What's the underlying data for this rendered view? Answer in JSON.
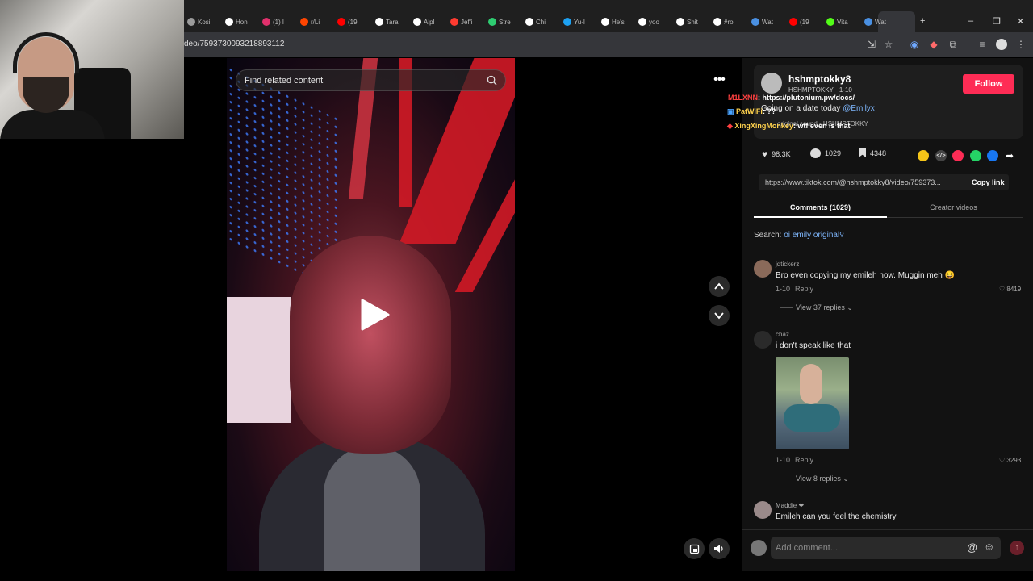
{
  "browser": {
    "tabs": [
      {
        "label": "Kosi",
        "color": "#9b9b9b"
      },
      {
        "label": "Hon",
        "color": "#ffffff"
      },
      {
        "label": "(1) l",
        "color": "#e1306c"
      },
      {
        "label": "r/Li",
        "color": "#ff4500"
      },
      {
        "label": "(19",
        "color": "#ff0000"
      },
      {
        "label": "Tara",
        "color": "#ffffff"
      },
      {
        "label": "Alpl",
        "color": "#ffffff"
      },
      {
        "label": "Jeffi",
        "color": "#ff3b30"
      },
      {
        "label": "Stre",
        "color": "#2ecc71"
      },
      {
        "label": "Chi",
        "color": "#ffffff"
      },
      {
        "label": "Yu-l",
        "color": "#1da1f2"
      },
      {
        "label": "He's",
        "color": "#ffffff"
      },
      {
        "label": "yoo",
        "color": "#ffffff"
      },
      {
        "label": "Shit",
        "color": "#ffffff"
      },
      {
        "label": "#rol",
        "color": "#ffffff"
      },
      {
        "label": "Wat",
        "color": "#4a90e2"
      },
      {
        "label": "(19",
        "color": "#ff0000"
      },
      {
        "label": "Vita",
        "color": "#53fc18"
      },
      {
        "label": "Wat",
        "color": "#4a90e2"
      }
    ],
    "url": "deo/7593730093218893112",
    "window_controls": {
      "minimize": "–",
      "restore": "❐",
      "close": "✕"
    },
    "new_tab": "+"
  },
  "video": {
    "search_placeholder": "Find related content"
  },
  "author": {
    "name": "hshmptokky8",
    "sub": "HSHMPTOKKY · 1-10",
    "follow_label": "Follow",
    "caption_text": "Going on a date today",
    "caption_mention": "@Emilyx",
    "sound": "original sound - HSHMPTOKKY"
  },
  "chat": [
    {
      "user": "M1LXNN",
      "text": ": https://plutonium.pw/docs/",
      "user_color": "#ff4040"
    },
    {
      "user": "PatWiFi",
      "text": ": ??",
      "user_color": "#ffd24d"
    },
    {
      "user": "XingXingMonkey",
      "text": ": wtf even is that",
      "user_color": "#ffd24d"
    }
  ],
  "stats": {
    "likes": "98.3K",
    "comments": "1029",
    "saves": "4348"
  },
  "link": {
    "url": "https://www.tiktok.com/@hshmptokky8/video/759373...",
    "copy_label": "Copy link"
  },
  "panel_tabs": {
    "comments": "Comments (1029)",
    "creator": "Creator videos"
  },
  "search_line": {
    "label": "Search:",
    "query": "oi emily original"
  },
  "comments": [
    {
      "user": "jdtickerz",
      "text": "Bro even copying my emileh now. Muggin meh 😆",
      "date": "1-10",
      "reply": "Reply",
      "likes": "8419",
      "view_replies": "View 37 replies"
    },
    {
      "user": "chaz",
      "text": "i don't speak like that",
      "date": "1-10",
      "reply": "Reply",
      "likes": "3293",
      "view_replies": "View 8 replies"
    },
    {
      "user": "Maddie ❤",
      "text": "Emileh can you feel the chemistry"
    }
  ],
  "add_comment": {
    "placeholder": "Add comment..."
  }
}
